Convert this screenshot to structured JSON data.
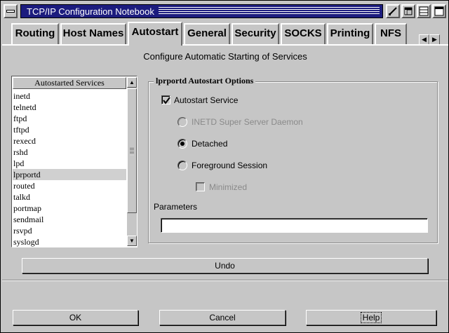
{
  "window": {
    "title": "TCP/IP Configuration Notebook"
  },
  "tabs": [
    {
      "label": "Routing",
      "active": false
    },
    {
      "label": "Host Names",
      "active": false
    },
    {
      "label": "Autostart",
      "active": true
    },
    {
      "label": "General",
      "active": false
    },
    {
      "label": "Security",
      "active": false
    },
    {
      "label": "SOCKS",
      "active": false
    },
    {
      "label": "Printing",
      "active": false
    },
    {
      "label": "NFS",
      "active": false
    }
  ],
  "page": {
    "heading": "Configure Automatic Starting of Services"
  },
  "services": {
    "header": "Autostarted Services",
    "items": [
      "inetd",
      "telnetd",
      "ftpd",
      "tftpd",
      "rexecd",
      "rshd",
      "lpd",
      "lprportd",
      "routed",
      "talkd",
      "portmap",
      "sendmail",
      "rsvpd",
      "syslogd"
    ],
    "selected": "lprportd"
  },
  "options": {
    "group_title": "lprportd Autostart Options",
    "autostart_label": "Autostart Service",
    "autostart_checked": true,
    "inetd_label": "INETD Super Server Daemon",
    "detached_label": "Detached",
    "foreground_label": "Foreground Session",
    "minimized_label": "Minimized",
    "selected_mode": "Detached",
    "parameters_label": "Parameters",
    "parameters_value": ""
  },
  "buttons": {
    "undo": "Undo",
    "ok": "OK",
    "cancel": "Cancel",
    "help": "Help"
  },
  "colors": {
    "titlebar": "#1c1c7e",
    "face": "#c6c6c6"
  }
}
